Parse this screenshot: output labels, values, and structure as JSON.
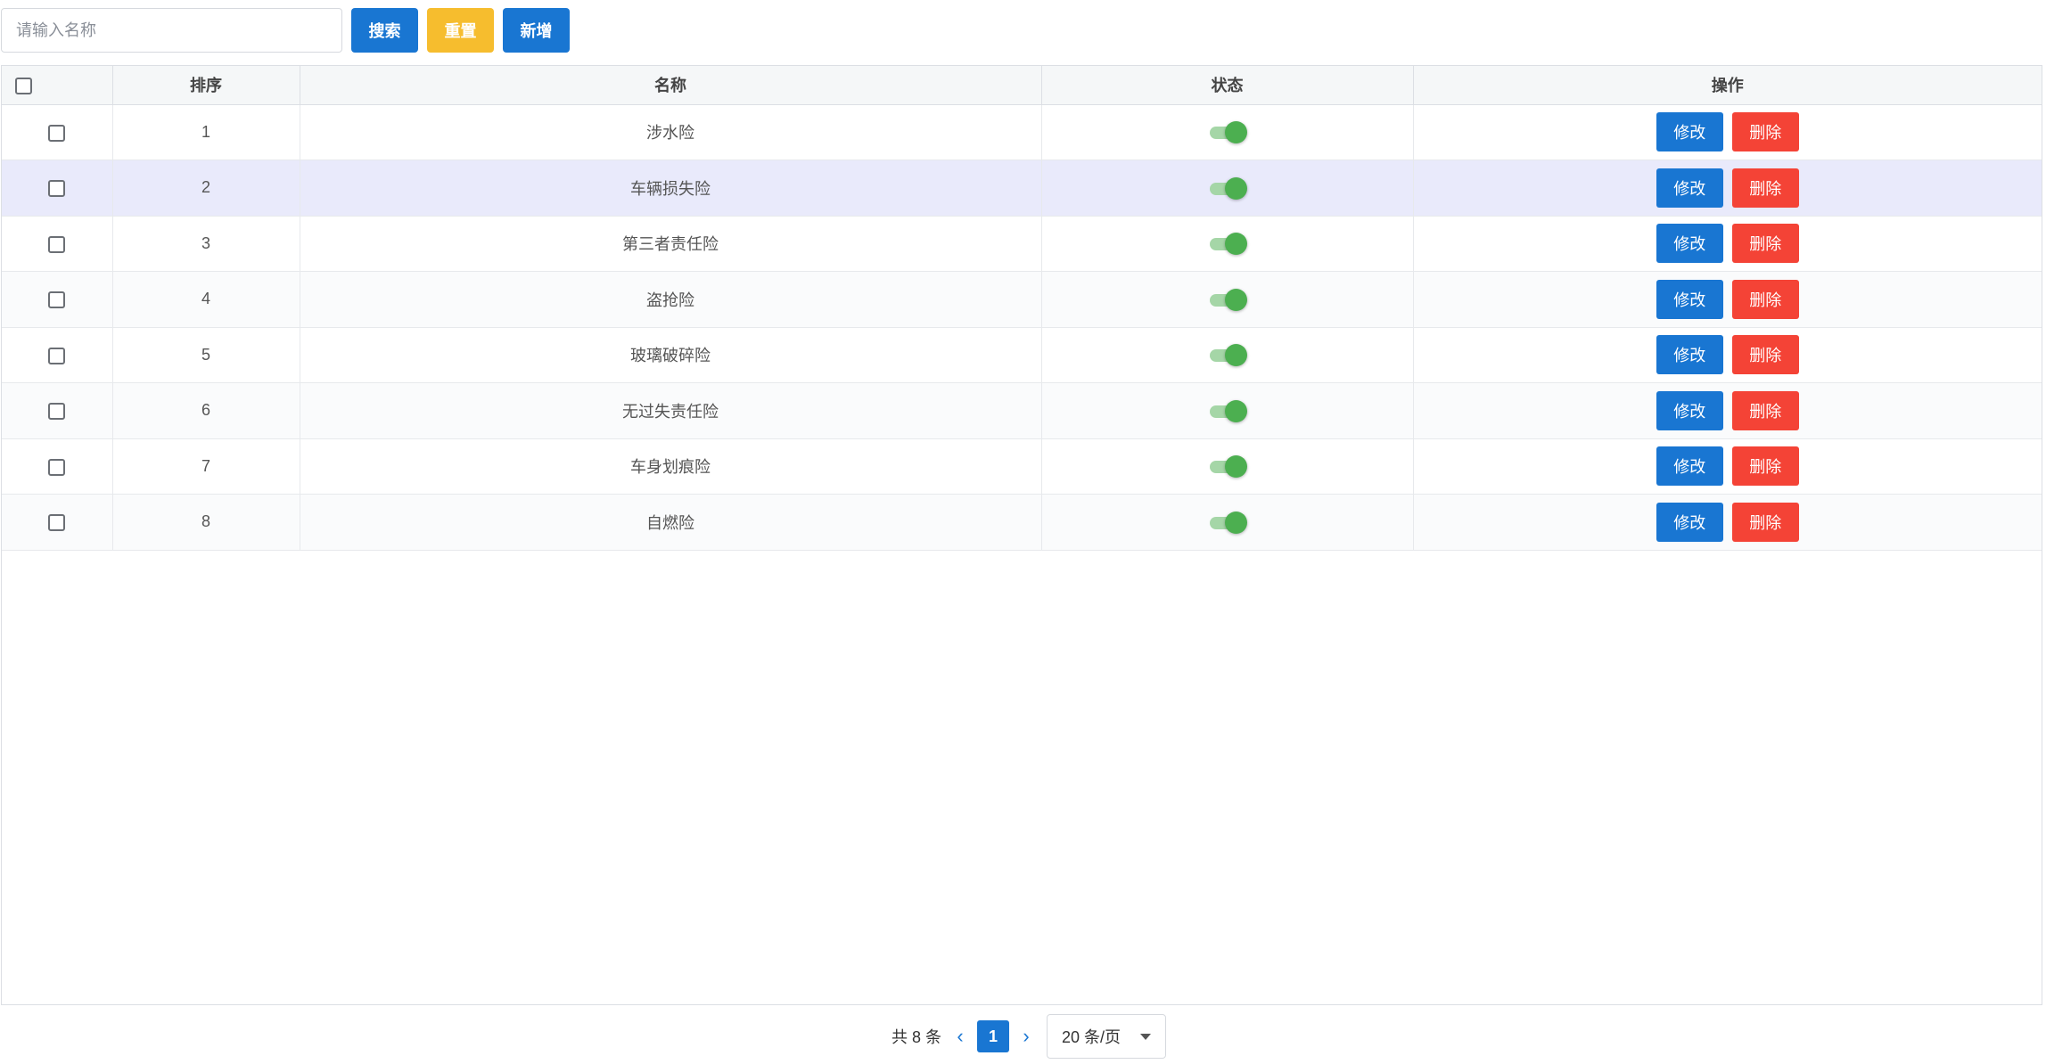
{
  "toolbar": {
    "search_placeholder": "请输入名称",
    "search_label": "搜索",
    "reset_label": "重置",
    "add_label": "新增"
  },
  "table": {
    "columns": [
      "排序",
      "名称",
      "状态",
      "操作"
    ],
    "edit_label": "修改",
    "delete_label": "删除",
    "rows": [
      {
        "order": "1",
        "name": "涉水险",
        "status_on": true
      },
      {
        "order": "2",
        "name": "车辆损失险",
        "status_on": true
      },
      {
        "order": "3",
        "name": "第三者责任险",
        "status_on": true
      },
      {
        "order": "4",
        "name": "盗抢险",
        "status_on": true
      },
      {
        "order": "5",
        "name": "玻璃破碎险",
        "status_on": true
      },
      {
        "order": "6",
        "name": "无过失责任险",
        "status_on": true
      },
      {
        "order": "7",
        "name": "车身划痕险",
        "status_on": true
      },
      {
        "order": "8",
        "name": "自燃险",
        "status_on": true
      }
    ]
  },
  "pagination": {
    "total_text": "共 8 条",
    "current_page": "1",
    "page_size": "20 条/页"
  },
  "colors": {
    "primary": "#1976d2",
    "warning": "#f6bd2e",
    "danger": "#f44336",
    "switch_on": "#4caf50",
    "highlight_row": "#e9eafb"
  },
  "icons": {
    "prev": "chevron-left-icon",
    "next": "chevron-right-icon",
    "caret": "caret-down-icon"
  }
}
